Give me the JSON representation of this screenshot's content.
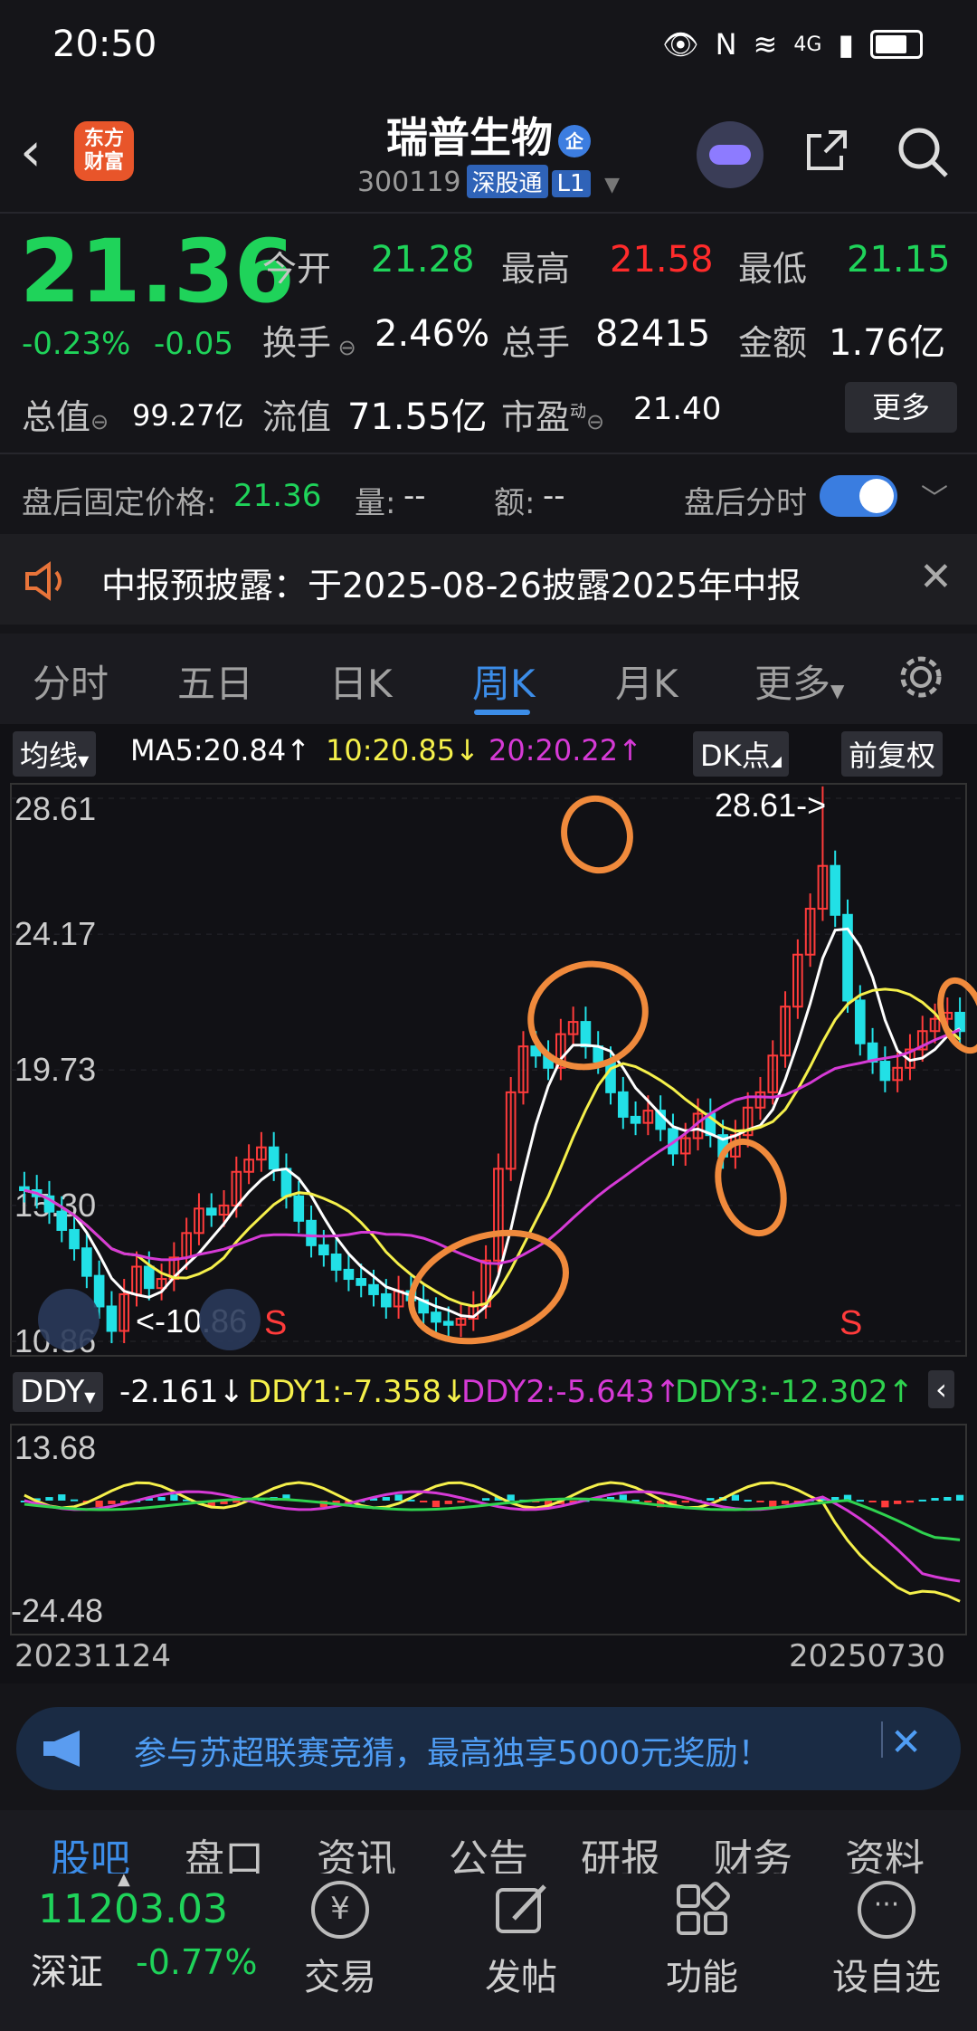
{
  "status_bar": {
    "time": "20:50",
    "network": "4G"
  },
  "header": {
    "logo_text": "东方财富",
    "stock_name": "瑞普生物",
    "ent_badge": "企",
    "code": "300119",
    "tag1": "深股通",
    "tag2": "L1"
  },
  "quote": {
    "price": "21.36",
    "change_pct": "-0.23%",
    "change_abs": "-0.05",
    "open_label": "今开",
    "open": "21.28",
    "high_label": "最高",
    "high": "21.58",
    "low_label": "最低",
    "low": "21.15",
    "turnover_label": "换手",
    "turnover": "2.46%",
    "volume_label": "总手",
    "volume": "82415",
    "amount_label": "金额",
    "amount": "1.76亿",
    "mktcap_label": "总值",
    "mktcap": "99.27亿",
    "float_label": "流值",
    "float": "71.55亿",
    "pe_label": "市盈",
    "pe_sup": "动",
    "pe": "21.40",
    "more": "更多"
  },
  "after_hours": {
    "label": "盘后固定价格:",
    "price": "21.36",
    "vol_label": "量:",
    "vol": "--",
    "amt_label": "额:",
    "amt": "--",
    "toggle_label": "盘后分时",
    "toggle_on": true
  },
  "notice": {
    "text": "中报预披露：于2025-08-26披露2025年中报"
  },
  "tabs": [
    {
      "label": "分时"
    },
    {
      "label": "五日"
    },
    {
      "label": "日K"
    },
    {
      "label": "周K",
      "active": true
    },
    {
      "label": "月K"
    },
    {
      "label": "更多"
    }
  ],
  "ma_bar": {
    "dropdown": "均线",
    "ma5": "MA5:20.84↑",
    "ma10": "10:20.85↓",
    "ma20": "20:20.22↑",
    "dk": "DK点",
    "adjust": "前复权"
  },
  "chart_data": {
    "type": "candlestick",
    "period": "weekly",
    "y_ticks": [
      "28.61",
      "24.17",
      "19.73",
      "15.30",
      "10.86"
    ],
    "ylim": [
      10.86,
      28.61
    ],
    "high_marker": "28.61->",
    "low_marker": "<-10.86",
    "signals": [
      "S",
      "S"
    ],
    "x_start": "20231124",
    "x_end": "20250730",
    "colors": {
      "up": "#ff3b3b",
      "down": "#22e0e6",
      "ma5": "#ffffff",
      "ma10": "#f5f04b",
      "ma20": "#d63ad6"
    }
  },
  "ddy": {
    "dropdown": "DDY",
    "value": "-2.161↓",
    "ddy1": "DDY1:-7.358↓",
    "ddy2": "DDY2:-5.643↑",
    "ddy3": "DDY3:-12.302↑",
    "y_max": "13.68",
    "y_min": "-24.48"
  },
  "banner": {
    "text": "参与苏超联赛竞猜，最高独享5000元奖励！"
  },
  "bottom_tabs": [
    {
      "label": "股吧",
      "active": true
    },
    {
      "label": "盘口"
    },
    {
      "label": "资讯"
    },
    {
      "label": "公告"
    },
    {
      "label": "研报"
    },
    {
      "label": "财务"
    },
    {
      "label": "资料"
    }
  ],
  "index": {
    "value": "11203.03",
    "name": "深证",
    "change": "-0.77%"
  },
  "bottom_bar": [
    {
      "label": "交易",
      "icon": "yen-icon"
    },
    {
      "label": "发帖",
      "icon": "edit-icon"
    },
    {
      "label": "功能",
      "icon": "grid-icon"
    },
    {
      "label": "设自选",
      "icon": "more-icon"
    }
  ]
}
